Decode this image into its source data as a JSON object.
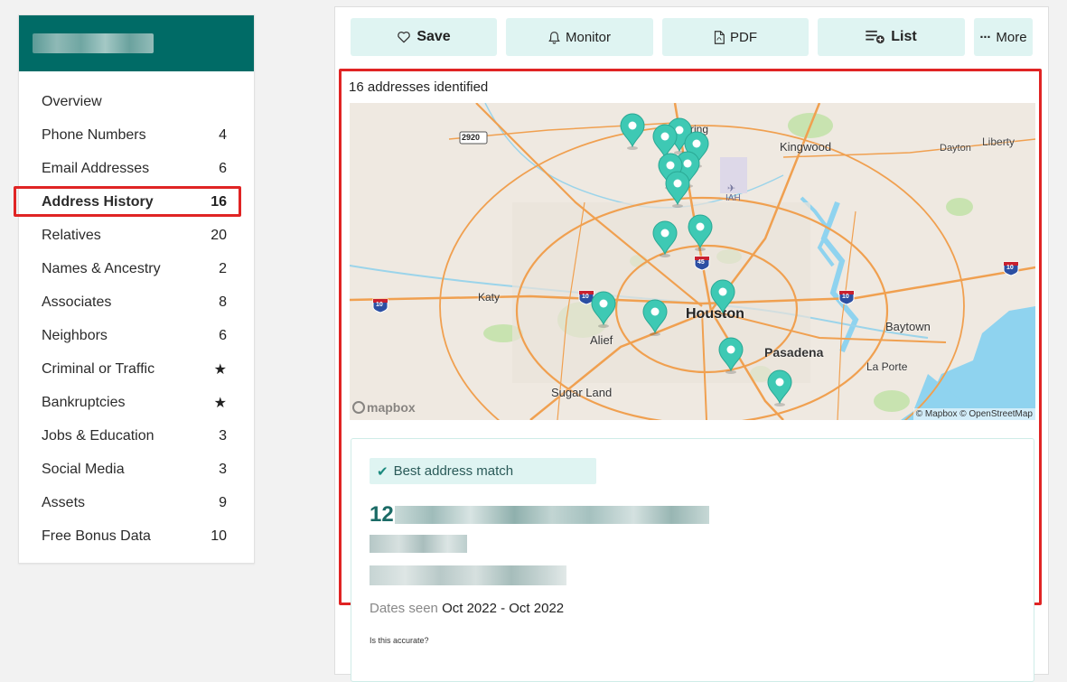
{
  "sidebar": {
    "items": [
      {
        "label": "Overview",
        "count": ""
      },
      {
        "label": "Phone Numbers",
        "count": "4"
      },
      {
        "label": "Email Addresses",
        "count": "6"
      },
      {
        "label": "Address History",
        "count": "16"
      },
      {
        "label": "Relatives",
        "count": "20"
      },
      {
        "label": "Names & Ancestry",
        "count": "2"
      },
      {
        "label": "Associates",
        "count": "8"
      },
      {
        "label": "Neighbors",
        "count": "6"
      },
      {
        "label": "Criminal or Traffic",
        "count": "★"
      },
      {
        "label": "Bankruptcies",
        "count": "★"
      },
      {
        "label": "Jobs & Education",
        "count": "3"
      },
      {
        "label": "Social Media",
        "count": "3"
      },
      {
        "label": "Assets",
        "count": "9"
      },
      {
        "label": "Free Bonus Data",
        "count": "10"
      }
    ],
    "active_index": 3,
    "header_color": "#006b66"
  },
  "toolbar": {
    "save_label": "Save",
    "monitor_label": "Monitor",
    "pdf_label": "PDF",
    "list_label": "List",
    "more_label": "More",
    "icons": [
      "heart-icon",
      "bell-icon",
      "pdf-icon",
      "list-add-icon",
      "ellipsis-icon"
    ]
  },
  "results": {
    "count_text": "16 addresses identified"
  },
  "map": {
    "labels": {
      "houston": "Houston",
      "pasadena": "Pasadena",
      "kingwood": "Kingwood",
      "dayton": "Dayton",
      "liberty": "Liberty",
      "katy": "Katy",
      "alief": "Alief",
      "sugar_land": "Sugar Land",
      "baytown": "Baytown",
      "la_porte": "La Porte",
      "spring": "ring",
      "iah": "IAH",
      "road_2920": "2920",
      "i10_a": "10",
      "i10_b": "10",
      "i10_c": "10",
      "i10_d": "10",
      "i45": "45"
    },
    "logo_text": "mapbox",
    "attribution": "© Mapbox © OpenStreetMap",
    "pin_color": "#3ec9b4",
    "water_color": "#7fd0f0"
  },
  "best_match": {
    "badge": "Best address match",
    "address_number": "12",
    "dates_label": "Dates seen",
    "dates_value": "Oct 2022 - Oct 2022",
    "accuracy_question": "Is this accurate?"
  }
}
